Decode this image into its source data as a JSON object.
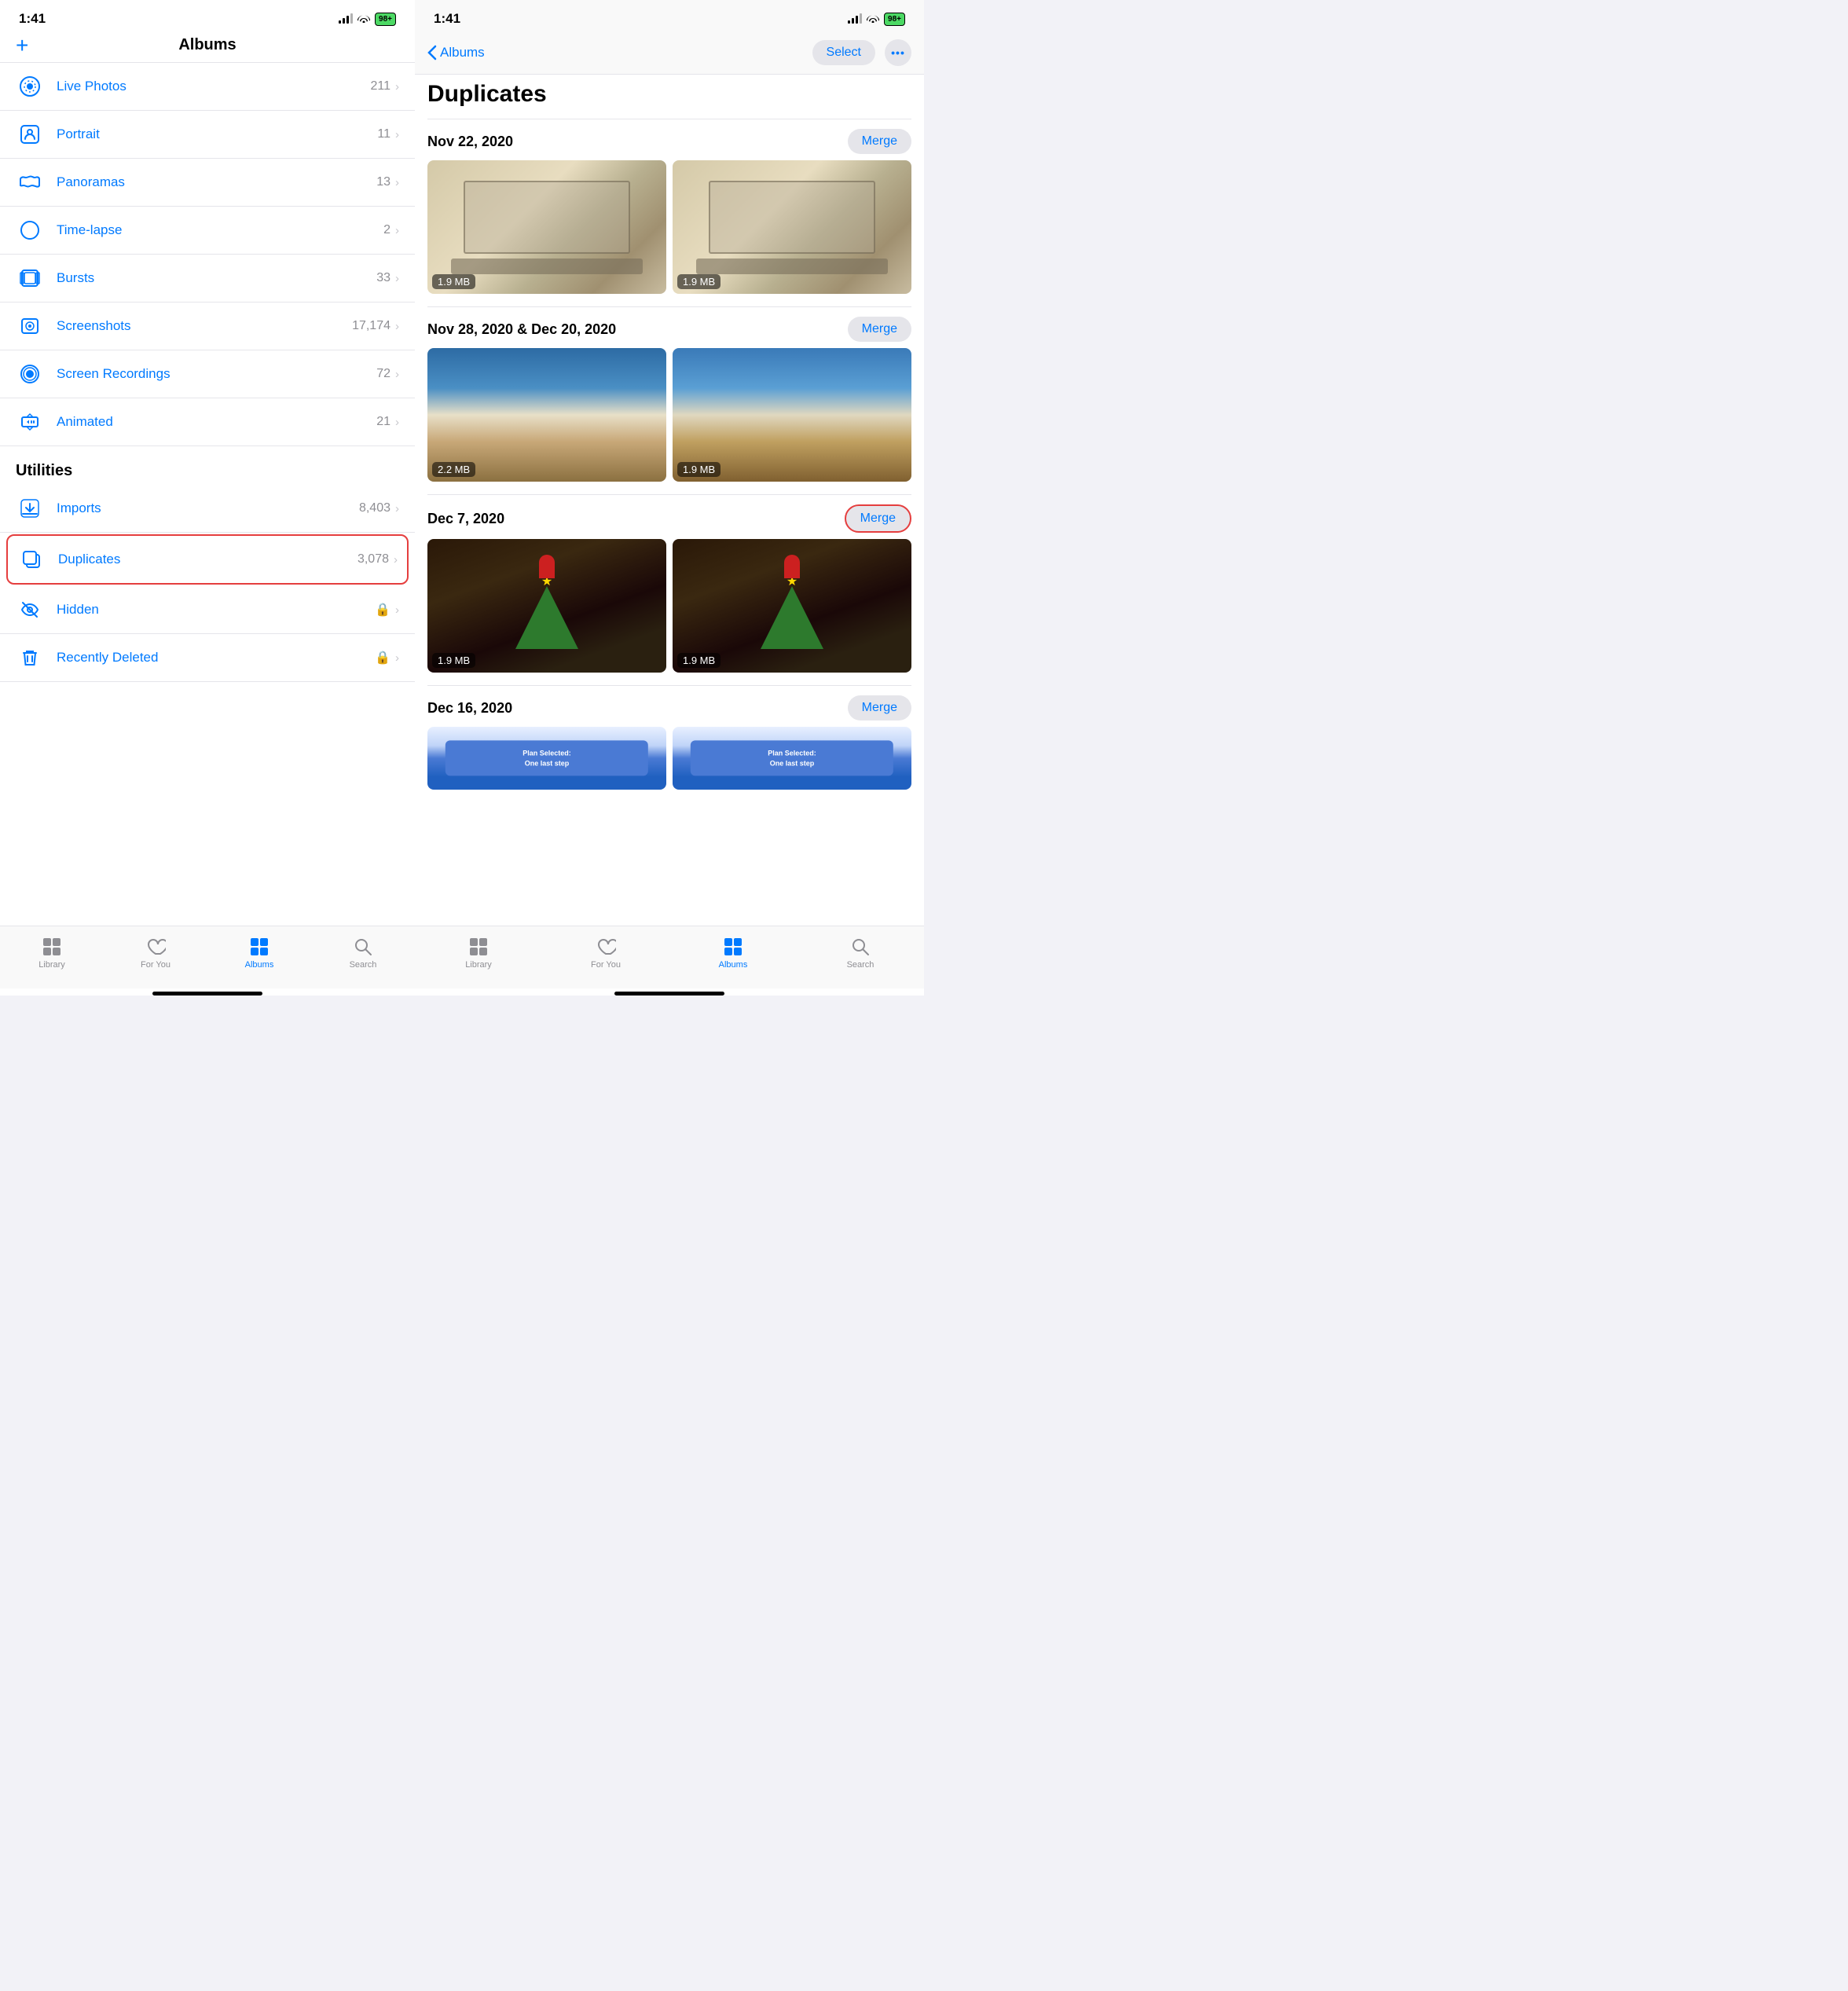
{
  "leftPanel": {
    "statusBar": {
      "time": "1:41",
      "battery": "98+"
    },
    "header": {
      "addLabel": "+",
      "title": "Albums"
    },
    "albumItems": [
      {
        "id": "live-photos",
        "name": "Live Photos",
        "count": "211",
        "icon": "live-photos-icon"
      },
      {
        "id": "portrait",
        "name": "Portrait",
        "count": "11",
        "icon": "portrait-icon"
      },
      {
        "id": "panoramas",
        "name": "Panoramas",
        "count": "13",
        "icon": "panoramas-icon"
      },
      {
        "id": "time-lapse",
        "name": "Time-lapse",
        "count": "2",
        "icon": "timelapse-icon"
      },
      {
        "id": "bursts",
        "name": "Bursts",
        "count": "33",
        "icon": "bursts-icon"
      },
      {
        "id": "screenshots",
        "name": "Screenshots",
        "count": "17,174",
        "icon": "screenshots-icon"
      },
      {
        "id": "screen-recordings",
        "name": "Screen Recordings",
        "count": "72",
        "icon": "screenrecordings-icon"
      },
      {
        "id": "animated",
        "name": "Animated",
        "count": "21",
        "icon": "animated-icon"
      }
    ],
    "utilitiesHeader": "Utilities",
    "utilityItems": [
      {
        "id": "imports",
        "name": "Imports",
        "count": "8,403",
        "icon": "imports-icon",
        "highlighted": false
      },
      {
        "id": "duplicates",
        "name": "Duplicates",
        "count": "3,078",
        "icon": "duplicates-icon",
        "highlighted": true
      },
      {
        "id": "hidden",
        "name": "Hidden",
        "count": "",
        "icon": "hidden-icon",
        "lock": true,
        "highlighted": false
      },
      {
        "id": "recently-deleted",
        "name": "Recently Deleted",
        "count": "",
        "icon": "recently-deleted-icon",
        "lock": true,
        "highlighted": false
      }
    ],
    "tabBar": {
      "tabs": [
        {
          "id": "library",
          "label": "Library",
          "active": false
        },
        {
          "id": "for-you",
          "label": "For You",
          "active": false
        },
        {
          "id": "albums",
          "label": "Albums",
          "active": true
        },
        {
          "id": "search",
          "label": "Search",
          "active": false
        }
      ]
    }
  },
  "rightPanel": {
    "statusBar": {
      "time": "1:41",
      "battery": "98+"
    },
    "nav": {
      "backLabel": "Albums",
      "selectLabel": "Select",
      "moreLabel": "···"
    },
    "title": "Duplicates",
    "groups": [
      {
        "id": "group1",
        "date": "Nov 22, 2020",
        "mergeLabel": "Merge",
        "highlighted": false,
        "photos": [
          {
            "size": "1.9 MB",
            "type": "laptop"
          },
          {
            "size": "1.9 MB",
            "type": "laptop"
          }
        ]
      },
      {
        "id": "group2",
        "date": "Nov 28, 2020 & Dec 20, 2020",
        "mergeLabel": "Merge",
        "highlighted": false,
        "photos": [
          {
            "size": "2.2 MB",
            "type": "mountain"
          },
          {
            "size": "1.9 MB",
            "type": "mountain2"
          }
        ]
      },
      {
        "id": "group3",
        "date": "Dec 7, 2020",
        "mergeLabel": "Merge",
        "highlighted": true,
        "photos": [
          {
            "size": "1.9 MB",
            "type": "xmas"
          },
          {
            "size": "1.9 MB",
            "type": "xmas"
          }
        ]
      },
      {
        "id": "group4",
        "date": "Dec 16, 2020",
        "mergeLabel": "Merge",
        "highlighted": false,
        "photos": [
          {
            "size": "",
            "type": "plan"
          },
          {
            "size": "",
            "type": "plan"
          }
        ]
      }
    ],
    "tabBar": {
      "tabs": [
        {
          "id": "library",
          "label": "Library",
          "active": false
        },
        {
          "id": "for-you",
          "label": "For You",
          "active": false
        },
        {
          "id": "albums",
          "label": "Albums",
          "active": true
        },
        {
          "id": "search",
          "label": "Search",
          "active": false
        }
      ]
    }
  }
}
